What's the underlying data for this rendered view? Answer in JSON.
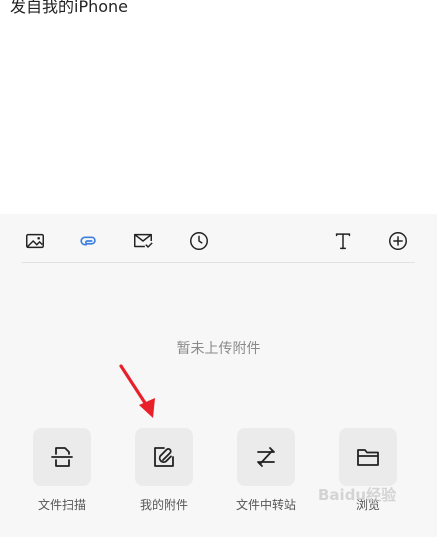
{
  "compose": {
    "signature": "发自我的iPhone"
  },
  "toolbar": {
    "icons": [
      "image-icon",
      "attachment-icon",
      "mail-check-icon",
      "clock-icon",
      "text-icon",
      "add-icon"
    ],
    "active": "attachment-icon"
  },
  "attachments": {
    "empty_text": "暂未上传附件"
  },
  "actions": [
    {
      "label": "文件扫描",
      "icon": "scan-file-icon"
    },
    {
      "label": "我的附件",
      "icon": "my-attachments-icon"
    },
    {
      "label": "文件中转站",
      "icon": "transfer-icon"
    },
    {
      "label": "浏览",
      "icon": "folder-icon"
    }
  ],
  "colors": {
    "accent": "#3d7fe0",
    "annotation": "#e8202a",
    "panel_bg": "#f7f7f7"
  },
  "watermark": "Baidu经验"
}
